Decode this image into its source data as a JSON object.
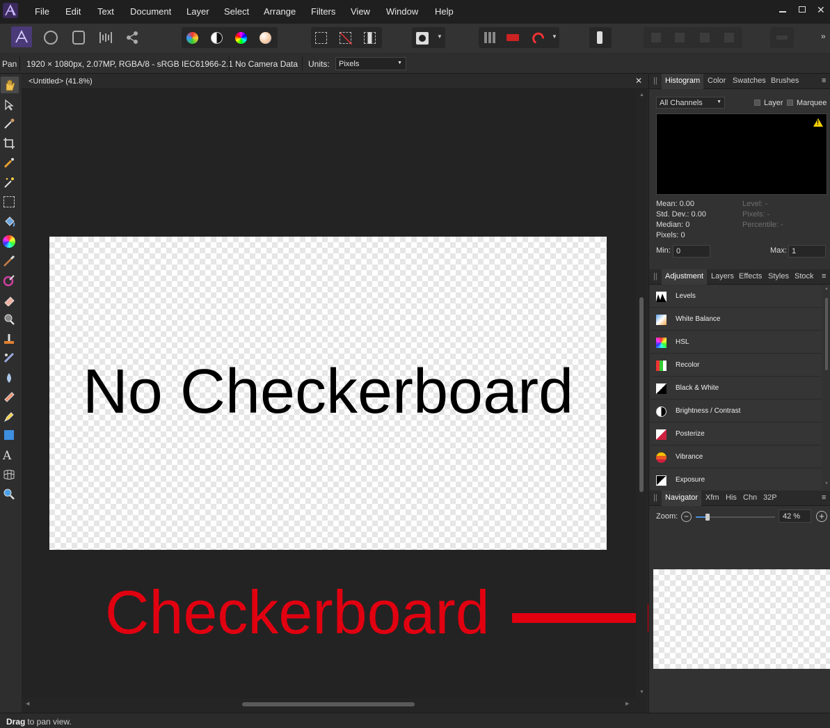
{
  "menu": [
    "File",
    "Edit",
    "Text",
    "Document",
    "Layer",
    "Select",
    "Arrange",
    "Filters",
    "View",
    "Window",
    "Help"
  ],
  "context_bar": {
    "tool_name": "Pan",
    "doc_info": "1920 × 1080px, 2.07MP, RGBA/8 - sRGB IEC61966-2.1",
    "camera": "No Camera Data",
    "units_label": "Units:",
    "units_value": "Pixels"
  },
  "document": {
    "tab_title": "<Untitled> (41.8%)"
  },
  "canvas_text": "No Checkerboard",
  "annotation": {
    "text": "Checkerboard",
    "color": "#e10010"
  },
  "histogram_panel": {
    "tabs": [
      "Histogram",
      "Color",
      "Swatches",
      "Brushes"
    ],
    "channel": "All Channels",
    "layer_label": "Layer",
    "marquee_label": "Marquee",
    "stats_left": [
      "Mean: 0.00",
      "Std. Dev.: 0.00",
      "Median: 0",
      "Pixels: 0"
    ],
    "stats_right": [
      "Level: -",
      "Pixels: -",
      "Percentile: -"
    ],
    "min_label": "Min:",
    "min_value": "0",
    "max_label": "Max:",
    "max_value": "1"
  },
  "adjustment_panel": {
    "tabs": [
      "Adjustment",
      "Layers",
      "Effects",
      "Styles",
      "Stock"
    ],
    "items": [
      "Levels",
      "White Balance",
      "HSL",
      "Recolor",
      "Black & White",
      "Brightness / Contrast",
      "Posterize",
      "Vibrance",
      "Exposure"
    ]
  },
  "navigator_panel": {
    "tabs": [
      "Navigator",
      "Xfm",
      "His",
      "Chn",
      "32P"
    ],
    "zoom_label": "Zoom:",
    "zoom_value": "42 %",
    "zoom_fraction": 0.42
  },
  "status": {
    "bold": "Drag",
    "text": " to pan view."
  }
}
